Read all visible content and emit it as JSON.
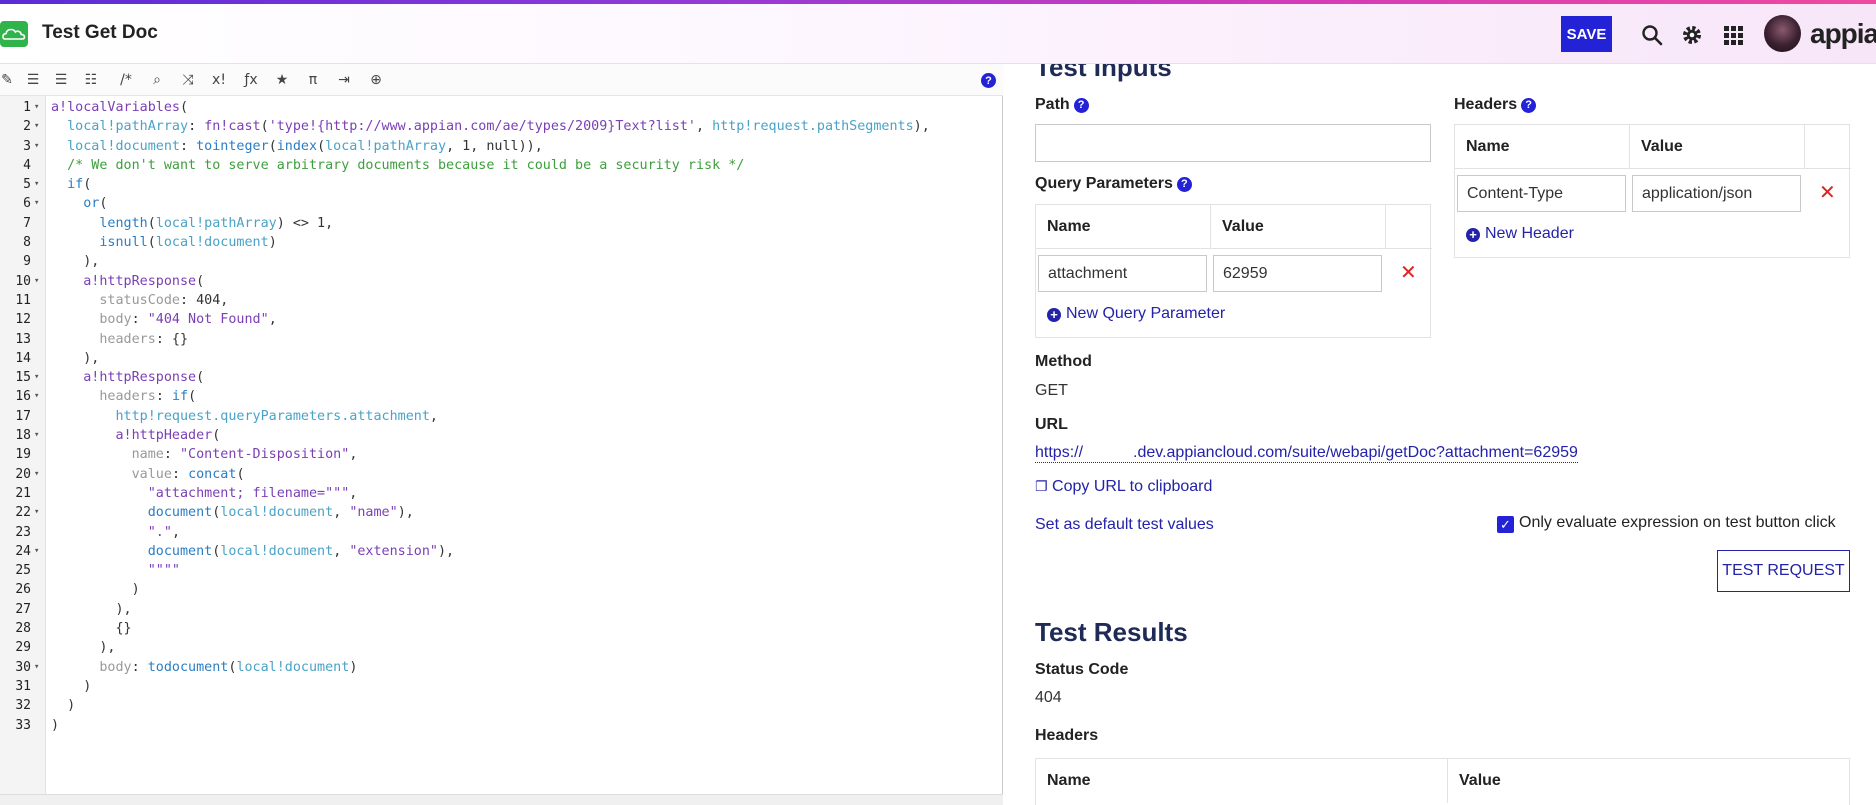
{
  "header": {
    "title": "Test Get Doc",
    "save_label": "SAVE",
    "brand": "appian"
  },
  "editor": {
    "lines": [
      {
        "n": "1",
        "fold": true
      },
      {
        "n": "2",
        "fold": true
      },
      {
        "n": "3",
        "fold": true
      },
      {
        "n": "4",
        "fold": false
      },
      {
        "n": "5",
        "fold": true
      },
      {
        "n": "6",
        "fold": true
      },
      {
        "n": "7",
        "fold": false
      },
      {
        "n": "8",
        "fold": false
      },
      {
        "n": "9",
        "fold": false
      },
      {
        "n": "10",
        "fold": true
      },
      {
        "n": "11",
        "fold": false
      },
      {
        "n": "12",
        "fold": false
      },
      {
        "n": "13",
        "fold": false
      },
      {
        "n": "14",
        "fold": false
      },
      {
        "n": "15",
        "fold": true
      },
      {
        "n": "16",
        "fold": true
      },
      {
        "n": "17",
        "fold": false
      },
      {
        "n": "18",
        "fold": true
      },
      {
        "n": "19",
        "fold": false
      },
      {
        "n": "20",
        "fold": true
      },
      {
        "n": "21",
        "fold": false
      },
      {
        "n": "22",
        "fold": true
      },
      {
        "n": "23",
        "fold": false
      },
      {
        "n": "24",
        "fold": true
      },
      {
        "n": "25",
        "fold": false
      },
      {
        "n": "26",
        "fold": false
      },
      {
        "n": "27",
        "fold": false
      },
      {
        "n": "28",
        "fold": false
      },
      {
        "n": "29",
        "fold": false
      },
      {
        "n": "30",
        "fold": true
      },
      {
        "n": "31",
        "fold": false
      },
      {
        "n": "32",
        "fold": false
      },
      {
        "n": "33",
        "fold": false
      }
    ],
    "code": [
      "a!localVariables(",
      "  local!pathArray: fn!cast('type!{http://www.appian.com/ae/types/2009}Text?list', http!request.pathSegments),",
      "  local!document: tointeger(index(local!pathArray, 1, null)),",
      "  /* We don't want to serve arbitrary documents because it could be a security risk */",
      "  if(",
      "    or(",
      "      length(local!pathArray) <> 1,",
      "      isnull(local!document)",
      "    ),",
      "    a!httpResponse(",
      "      statusCode: 404,",
      "      body: \"404 Not Found\",",
      "      headers: {}",
      "    ),",
      "    a!httpResponse(",
      "      headers: if(",
      "        http!request.queryParameters.attachment,",
      "        a!httpHeader(",
      "          name: \"Content-Disposition\",",
      "          value: concat(",
      "            \"attachment; filename=\"\"\",",
      "            document(local!document, \"name\"),",
      "            \".\",",
      "            document(local!document, \"extension\"),",
      "            \"\"\"\"",
      "          )",
      "        ),",
      "        {}",
      "      ),",
      "      body: todocument(local!document)",
      "    )",
      "  )",
      ")"
    ]
  },
  "test_inputs": {
    "title": "Test Inputs",
    "path_label": "Path",
    "path_value": "",
    "headers_label": "Headers",
    "headers_col_name": "Name",
    "headers_col_value": "Value",
    "header_row": {
      "name": "Content-Type",
      "value": "application/json"
    },
    "new_header": "New Header",
    "query_label": "Query Parameters",
    "query_col_name": "Name",
    "query_col_value": "Value",
    "query_row": {
      "name": "attachment",
      "value": "62959"
    },
    "new_query": "New Query Parameter",
    "method_label": "Method",
    "method_value": "GET",
    "url_label": "URL",
    "url_prefix": "https://",
    "url_suffix": ".dev.appiancloud.com/suite/webapi/getDoc?attachment=62959",
    "copy_url": "Copy URL to clipboard",
    "set_default": "Set as default test values",
    "only_eval": "Only evaluate expression on test button click",
    "only_eval_checked": true,
    "test_button": "TEST REQUEST"
  },
  "test_results": {
    "title": "Test Results",
    "status_label": "Status Code",
    "status_value": "404",
    "headers_label": "Headers",
    "col_name": "Name",
    "col_value": "Value"
  }
}
